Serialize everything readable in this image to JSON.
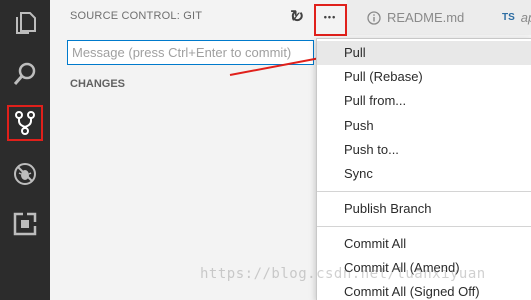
{
  "activity_bar": {
    "items": [
      {
        "name": "explorer-icon"
      },
      {
        "name": "search-icon"
      },
      {
        "name": "source-control-icon"
      },
      {
        "name": "debug-icon"
      },
      {
        "name": "extensions-icon"
      }
    ]
  },
  "sidebar": {
    "title": "SOURCE CONTROL: GIT",
    "commit_icon": "✓",
    "refresh_icon": "↻",
    "more_icon": "•••",
    "message_placeholder": "Message (press Ctrl+Enter to commit)",
    "changes_label": "CHANGES"
  },
  "tabs": [
    {
      "icon": "info-icon",
      "label": "README.md"
    },
    {
      "badge": "TS",
      "label": "ap"
    }
  ],
  "menu": {
    "items": [
      {
        "label": "Pull",
        "active": true
      },
      {
        "label": "Pull (Rebase)"
      },
      {
        "label": "Pull from..."
      },
      {
        "label": "Push"
      },
      {
        "label": "Push to..."
      },
      {
        "label": "Sync"
      },
      {
        "label": "Publish Branch"
      },
      {
        "label": "Commit All"
      },
      {
        "label": "Commit All (Amend)"
      },
      {
        "label": "Commit All (Signed Off)"
      }
    ]
  },
  "watermark": "https://blog.csdn.net/luanxiyuan",
  "colors": {
    "activity_bar": "#2c2c2c",
    "highlight": "#e0201b",
    "accent": "#007acc"
  }
}
